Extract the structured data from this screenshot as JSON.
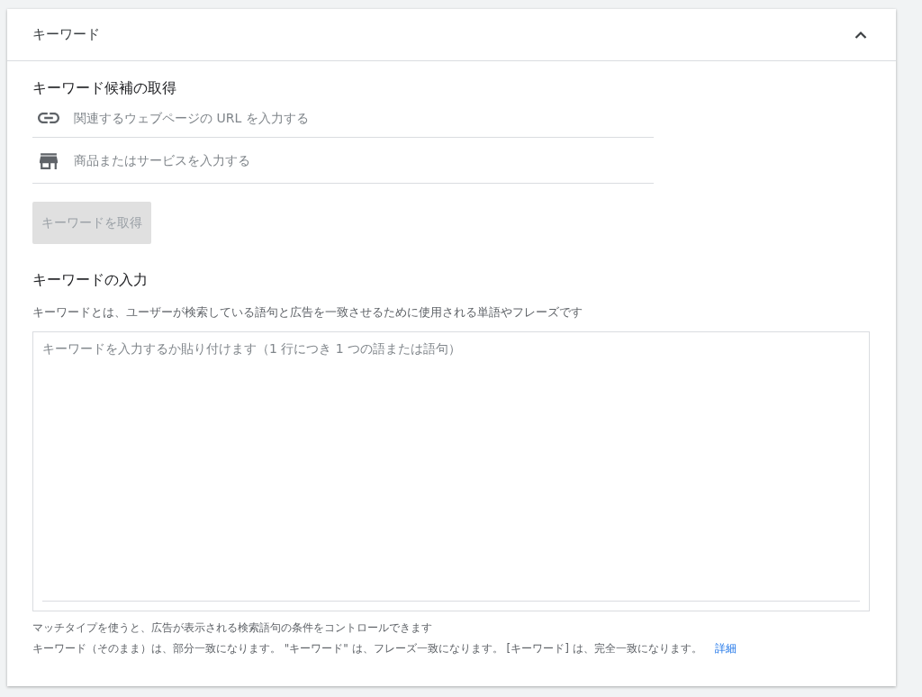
{
  "panel": {
    "title": "キーワード",
    "expanded": true
  },
  "suggest": {
    "heading": "キーワード候補の取得",
    "fields": [
      {
        "kind": "link",
        "placeholder": "関連するウェブページの URL を入力する"
      },
      {
        "kind": "store",
        "placeholder": "商品またはサービスを入力する"
      }
    ],
    "button": {
      "label": "キーワードを取得",
      "disabled": true
    }
  },
  "entry": {
    "heading": "キーワードの入力",
    "description": "キーワードとは、ユーザーが検索している語句と広告を一致させるために使用される単語やフレーズです",
    "placeholder": "キーワードを入力するか貼り付けます（1 行につき 1 つの語または語句）"
  },
  "footer": {
    "line_1": "マッチタイプを使うと、広告が表示される検索語句の条件をコントロールできます",
    "line_2": "キーワード（そのまま）は、部分一致になります。 \"キーワード\" は、フレーズ一致になります。 [キーワード] は、完全一致になります。",
    "link": "詳細"
  }
}
